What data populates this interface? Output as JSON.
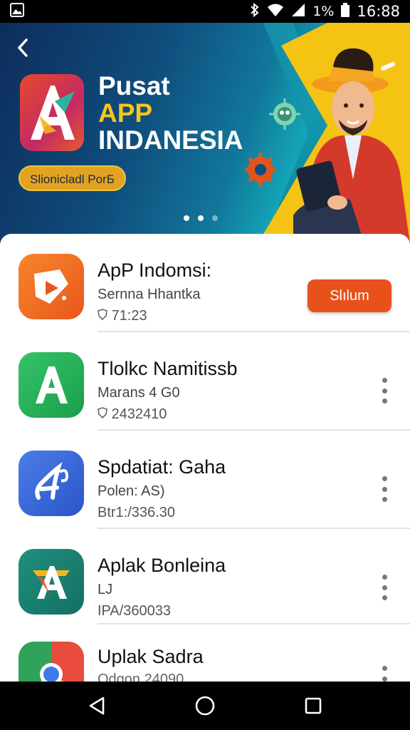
{
  "status_bar": {
    "battery_text": "1%",
    "time": "16:88"
  },
  "hero": {
    "title_line1": "Pusat",
    "title_line2": "APP",
    "title_line3": "INDANESIA",
    "badge": "Slionicladl PorБ",
    "slide_count": 3,
    "active_slide": 2
  },
  "apps": [
    {
      "name": "ApP Indomsi:",
      "subtitle": "Sernna Hhantka",
      "meta": "71:23",
      "action": "Slılum"
    },
    {
      "name": "Tlolkc Namitissb",
      "subtitle": "Marans 4 G0",
      "meta": "2432410"
    },
    {
      "name": "Spdatiat: Gaha",
      "subtitle": "Polen: AS)",
      "meta": "Btr1:/336.30"
    },
    {
      "name": "Aplak Bonleina",
      "subtitle": "LJ",
      "meta": "IPA/360033"
    },
    {
      "name": "Uplak Sadra",
      "subtitle": "Odgon 24090",
      "meta": ""
    }
  ],
  "colors": {
    "accent": "#e8511b",
    "hero_yellow": "#f5c314",
    "hero_blue": "#0f4d7d"
  }
}
